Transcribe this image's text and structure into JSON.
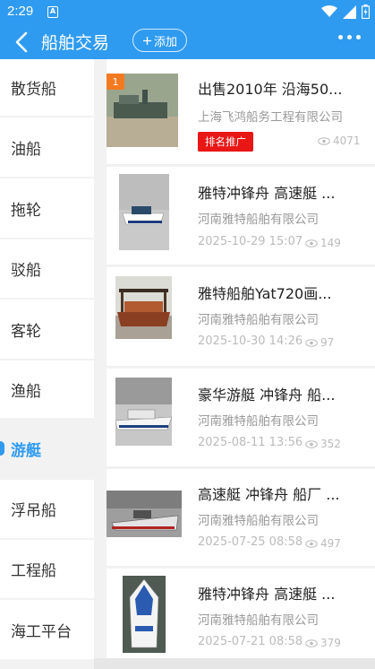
{
  "status_bar": {
    "time": "2:29",
    "sim_label": "A"
  },
  "header": {
    "title": "船舶交易",
    "add_label": "添加"
  },
  "sidebar": {
    "items": [
      {
        "label": "散货船",
        "active": false
      },
      {
        "label": "油船",
        "active": false
      },
      {
        "label": "拖轮",
        "active": false
      },
      {
        "label": "驳船",
        "active": false
      },
      {
        "label": "客轮",
        "active": false
      },
      {
        "label": "渔船",
        "active": false
      },
      {
        "label": "游艇",
        "active": true
      },
      {
        "label": "浮吊船",
        "active": false
      },
      {
        "label": "工程船",
        "active": false
      },
      {
        "label": "海工平台",
        "active": false
      }
    ]
  },
  "listings": [
    {
      "title": "出售2010年 沿海50...",
      "company": "上海飞鸿船务工程有限公司",
      "badge": "排名推广",
      "rank": "1",
      "views": "4071",
      "date": ""
    },
    {
      "title": "雅特冲锋舟 高速艇 ...",
      "company": "河南雅特船舶有限公司",
      "date": "2025-10-29 15:07",
      "views": "149"
    },
    {
      "title": "雅特船舶Yat720画...",
      "company": "河南雅特船舶有限公司",
      "date": "2025-10-30 14:26",
      "views": "97"
    },
    {
      "title": "豪华游艇 冲锋舟 船...",
      "company": "河南雅特船舶有限公司",
      "date": "2025-08-11 13:56",
      "views": "352"
    },
    {
      "title": "高速艇 冲锋舟 船厂 ...",
      "company": "河南雅特船舶有限公司",
      "date": "2025-07-25 08:58",
      "views": "497"
    },
    {
      "title": "雅特冲锋舟 高速艇 ...",
      "company": "河南雅特船舶有限公司",
      "date": "2025-07-21 08:58",
      "views": "379"
    }
  ],
  "icons": {
    "back": "chevron-left-icon",
    "add": "plus-icon",
    "more": "more-dots-icon",
    "views": "eye-icon",
    "wifi": "wifi-icon",
    "signal": "signal-icon",
    "battery": "battery-icon"
  },
  "colors": {
    "primary": "#2f9bf0",
    "badge_red": "#e91616",
    "rank_orange": "#f47a21"
  }
}
